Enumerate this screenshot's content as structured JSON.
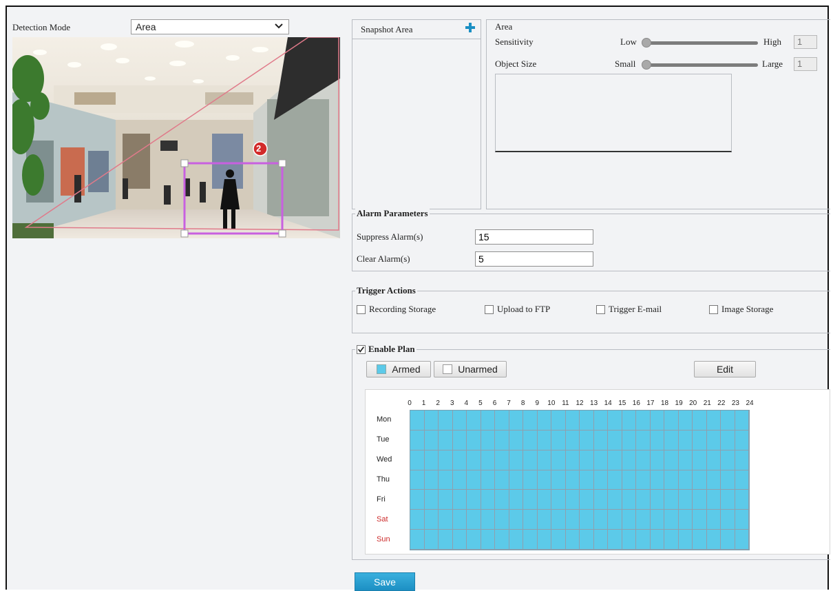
{
  "detection": {
    "label": "Detection Mode",
    "selected": "Area"
  },
  "snapshot_area": {
    "title": "Snapshot Area",
    "add_icon": "plus-icon",
    "marker_number": "2"
  },
  "area_settings": {
    "title": "Area",
    "sensitivity": {
      "label": "Sensitivity",
      "low": "Low",
      "high": "High",
      "value": "1",
      "level": 0.0
    },
    "object_size": {
      "label": "Object Size",
      "small": "Small",
      "large": "Large",
      "value": "1",
      "level": 0.0
    }
  },
  "alarm_parameters": {
    "legend": "Alarm Parameters",
    "suppress": {
      "label": "Suppress Alarm(s)",
      "value": "15"
    },
    "clear": {
      "label": "Clear Alarm(s)",
      "value": "5"
    }
  },
  "trigger_actions": {
    "legend": "Trigger Actions",
    "items": [
      {
        "label": "Recording Storage",
        "checked": false
      },
      {
        "label": "Upload to FTP",
        "checked": false
      },
      {
        "label": "Trigger E-mail",
        "checked": false
      },
      {
        "label": "Image Storage",
        "checked": false
      }
    ]
  },
  "plan": {
    "legend": "Enable Plan",
    "enabled": true,
    "armed_label": "Armed",
    "unarmed_label": "Unarmed",
    "edit_label": "Edit",
    "armed_color": "#5ccae9",
    "hours": [
      "0",
      "1",
      "2",
      "3",
      "4",
      "5",
      "6",
      "7",
      "8",
      "9",
      "10",
      "11",
      "12",
      "13",
      "14",
      "15",
      "16",
      "17",
      "18",
      "19",
      "20",
      "21",
      "22",
      "23",
      "24"
    ],
    "days": [
      "Mon",
      "Tue",
      "Wed",
      "Thu",
      "Fri",
      "Sat",
      "Sun"
    ],
    "weekend_days": [
      "Sat",
      "Sun"
    ],
    "weekend_color": "#cc2a2a"
  },
  "save_label": "Save"
}
